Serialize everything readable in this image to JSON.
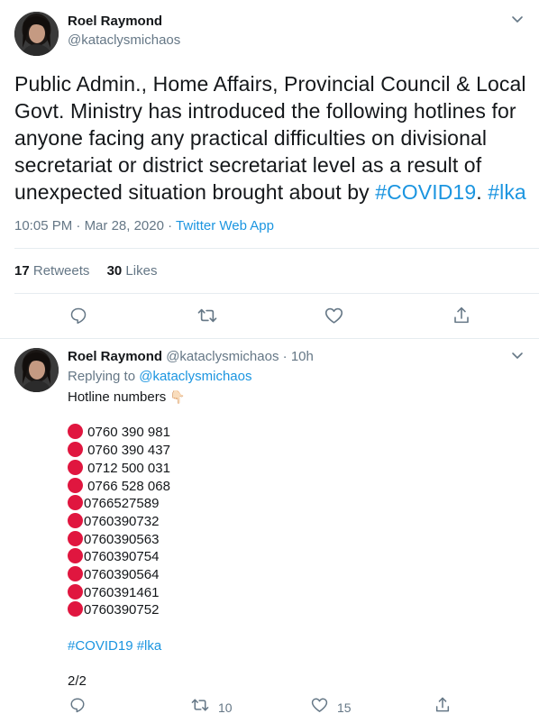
{
  "main_tweet": {
    "author_name": "Roel Raymond",
    "author_handle": "@kataclysmichaos",
    "text_lines": [
      "Public Admin., Home Affairs, Provincial Council & Local",
      "Govt. Ministry has introduced the following hotlines for",
      "anyone facing any practical difficulties on divisional",
      "secretariat or district secretariat level as a result of"
    ],
    "text_last_plain": "unexpected situation brought about by ",
    "hashtag_covid": "#COVID19",
    "text_dot": ".",
    "hashtag_lka": "#lka",
    "time": "10:05 PM",
    "sep": "·",
    "date": "Mar 28, 2020",
    "source": "Twitter Web App",
    "retweets_count": "17",
    "retweets_label": "Retweets",
    "likes_count": "30",
    "likes_label": "Likes"
  },
  "reply_tweet": {
    "author_name": "Roel Raymond",
    "author_handle": "@kataclysmichaos",
    "sep": "·",
    "time_ago": "10h",
    "replying_to_label": "Replying to",
    "replying_to_handle": "@kataclysmichaos",
    "intro": "Hotline numbers",
    "intro_emoji": "👇🏻",
    "numbers": [
      " 0760 390 981",
      " 0760 390 437",
      " 0712 500 031",
      " 0766 528 068",
      "0766527589",
      "0760390732",
      "0760390563",
      "0760390754",
      "0760390564",
      "0760391461",
      "0760390752"
    ],
    "hashtags": "#COVID19 #lka",
    "thread_index": "2/2",
    "retweets_count": "10",
    "likes_count": "15"
  },
  "icons": {
    "caret": "chevron-down-icon",
    "reply": "reply-icon",
    "retweet": "retweet-icon",
    "like": "heart-icon",
    "share": "share-icon",
    "number_bullet": "red-circle-icon"
  },
  "colors": {
    "link": "#1b95e0",
    "muted": "#657786",
    "text": "#14171a",
    "bullet": "#e0163f",
    "divider": "#e6ecf0"
  }
}
